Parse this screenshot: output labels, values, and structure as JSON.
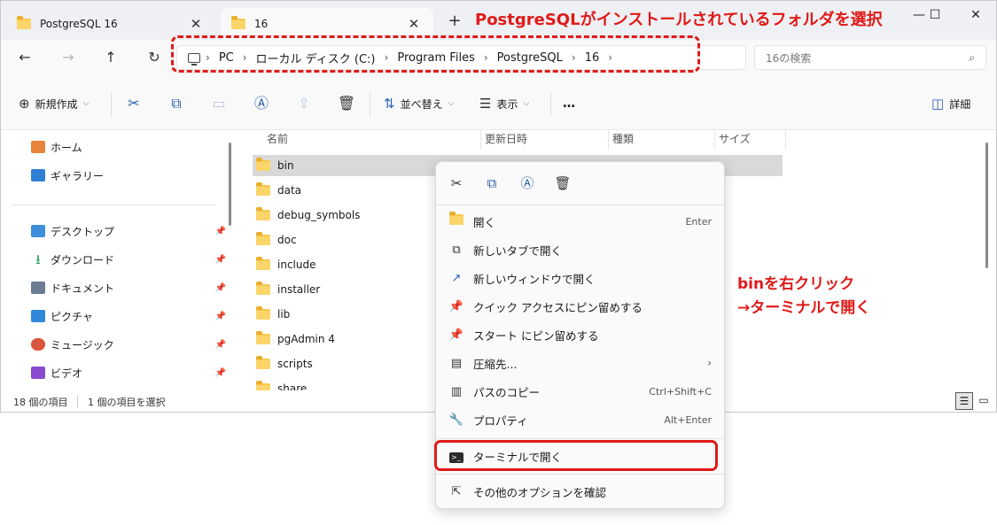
{
  "tabs": [
    {
      "label": "PostgreSQL 16"
    },
    {
      "label": "16"
    }
  ],
  "window_controls": {
    "minimize": "—",
    "maximize": "☐",
    "close": "✕"
  },
  "address": {
    "crumbs": [
      "PC",
      "ローカル ディスク (C:)",
      "Program Files",
      "PostgreSQL",
      "16"
    ]
  },
  "search": {
    "placeholder": "16の検索"
  },
  "command_bar": {
    "new_label": "新規作成",
    "sort_label": "並べ替え",
    "view_label": "表示",
    "more_label": "…",
    "details_label": "詳細"
  },
  "nav": {
    "home": "ホーム",
    "gallery": "ギャラリー",
    "desktop": "デスクトップ",
    "downloads": "ダウンロード",
    "documents": "ドキュメント",
    "pictures": "ピクチャ",
    "music": "ミュージック",
    "videos": "ビデオ"
  },
  "columns": {
    "name": "名前",
    "date": "更新日時",
    "type": "種類",
    "size": "サイズ"
  },
  "files": [
    "bin",
    "data",
    "debug_symbols",
    "doc",
    "include",
    "installer",
    "lib",
    "pgAdmin 4",
    "scripts",
    "share"
  ],
  "status": {
    "count": "18 個の項目",
    "selected": "1 個の項目を選択"
  },
  "context_menu": {
    "open": {
      "label": "開く",
      "shortcut": "Enter"
    },
    "open_new_tab": "新しいタブで開く",
    "open_new_window": "新しいウィンドウで開く",
    "pin_quick_access": "クイック アクセスにピン留めする",
    "pin_start": "スタート にピン留めする",
    "compress": "圧縮先...",
    "copy_path": {
      "label": "パスのコピー",
      "shortcut": "Ctrl+Shift+C"
    },
    "properties": {
      "label": "プロパティ",
      "shortcut": "Alt+Enter"
    },
    "open_terminal": "ターミナルで開く",
    "more_options": "その他のオプションを確認"
  },
  "annotations": {
    "title": "PostgreSQLがインストールされているフォルダを選択",
    "note_line1": "binを右クリック",
    "note_line2": "→ターミナルで開く",
    "accent_color": "#e01919"
  }
}
